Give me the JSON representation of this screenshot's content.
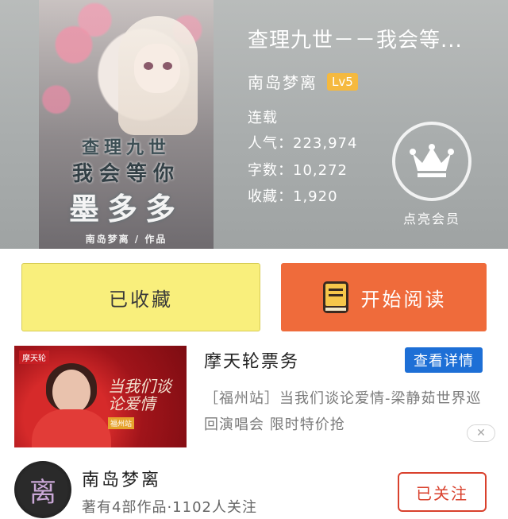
{
  "book": {
    "title": "查理九世－－我会等...",
    "author": "南岛梦离",
    "level": "Lv5",
    "status": "连载",
    "popularity": "人气：223,974",
    "words": "字数：10,272",
    "favorites": "收藏：1,920",
    "cover_text": {
      "line1": "查理九世",
      "line2": "我会等你",
      "line3": "墨多多",
      "line4": "南岛梦离 / 作品"
    }
  },
  "vip": {
    "label": "点亮会员",
    "icon": "crown-icon"
  },
  "actions": {
    "favorite_label": "已收藏",
    "read_label": "开始阅读",
    "read_icon": "book-icon",
    "favorite_color": "#f9ef7c",
    "read_color": "#ef6b3b"
  },
  "ad": {
    "title": "摩天轮票务",
    "detail_button": "查看详情",
    "description": "［福州站］当我们谈论爱情-梁静茹世界巡回演唱会 限时特价抢",
    "close_label": "✕",
    "image_text": {
      "logo": "摩天轮",
      "script": "当我们谈论爱情",
      "tag": "福州站"
    },
    "button_color": "#1d6fd6"
  },
  "author_footer": {
    "avatar_text": "离",
    "name": "南岛梦离",
    "stats": "著有4部作品·1102人关注",
    "follow_label": "已关注",
    "follow_color": "#d9412d"
  }
}
